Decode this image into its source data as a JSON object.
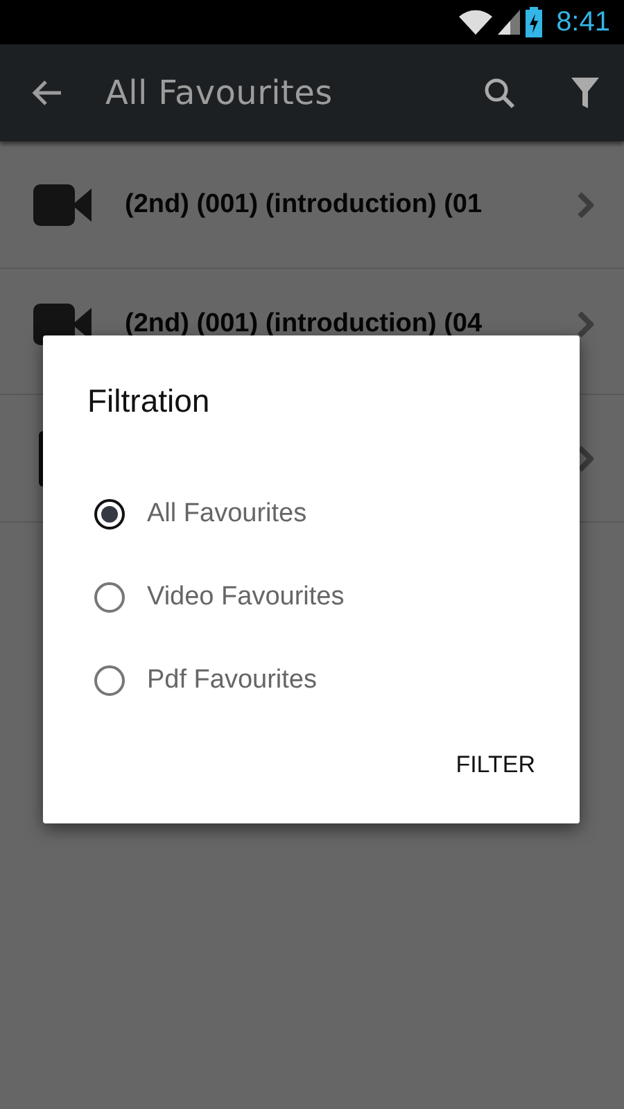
{
  "status_bar": {
    "time": "8:41"
  },
  "app_bar": {
    "title": "All Favourites"
  },
  "list": [
    {
      "kind": "video",
      "title": "(2nd) (001) (introduction) (01"
    },
    {
      "kind": "video",
      "title": "(2nd) (001) (introduction) (04"
    },
    {
      "kind": "document"
    }
  ],
  "dialog": {
    "title": "Filtration",
    "options": [
      {
        "label": "All Favourites",
        "selected": true
      },
      {
        "label": "Video Favourites",
        "selected": false
      },
      {
        "label": "Pdf Favourites",
        "selected": false
      }
    ],
    "button": "FILTER"
  }
}
